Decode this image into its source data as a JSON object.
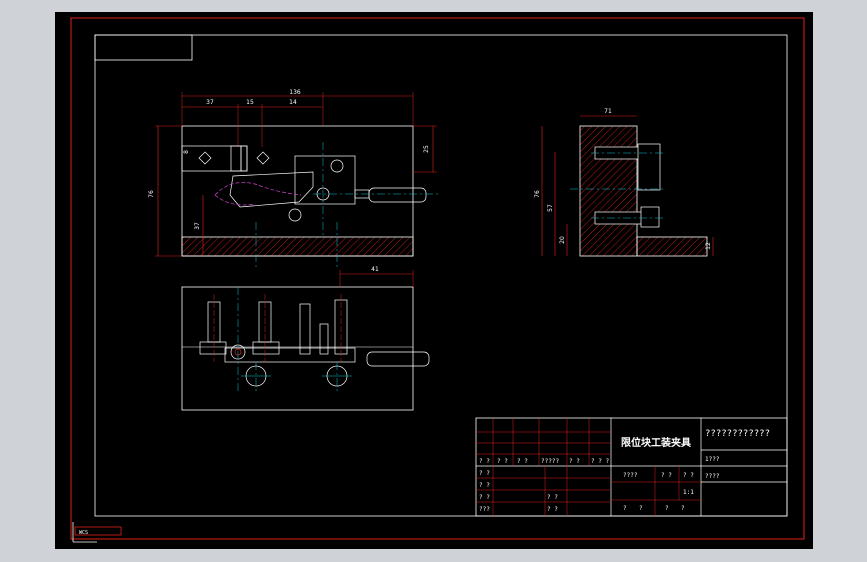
{
  "drawing": {
    "title": "限位块工装夹具",
    "header_code": "????????????",
    "dimensions": {
      "top_total": "136",
      "top_a": "37",
      "top_b": "15",
      "top_c": "14",
      "left_height": "76",
      "right_top": "25",
      "small_left": "8",
      "lower_37": "37",
      "plan_right": "41",
      "side_top": "71",
      "side_height": "76",
      "side_mid": "57",
      "side_low": "20",
      "side_right": "12"
    }
  },
  "title_block": {
    "row1": [
      "? ?",
      "? ?",
      "? ?",
      "?????",
      "? ?",
      "? ? ?"
    ],
    "row2_left": [
      "? ?",
      "? ?",
      "? ?",
      "???"
    ],
    "row2_mid": [
      "? ?",
      "? ?"
    ],
    "label_a": "????",
    "label_b": "? ?",
    "label_c": "? ?",
    "label_d": "1:1",
    "label_e": "1???",
    "label_f": "????",
    "bottom_left": [
      "?",
      "?",
      "?",
      "?"
    ]
  },
  "ucs_label": "WCS"
}
